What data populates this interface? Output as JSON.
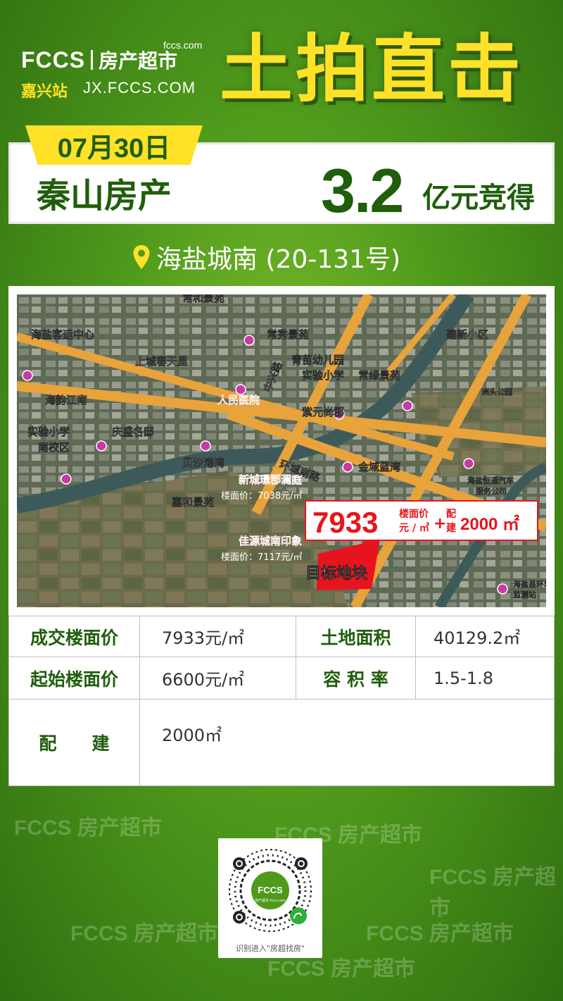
{
  "header": {
    "logo_small": "fccs.com",
    "logo_brand": "FCCS",
    "logo_cn": "房产超市",
    "station": "嘉兴站",
    "station_url": "JX.FCCS.COM",
    "headline": "土拍直击"
  },
  "result": {
    "date": "07月30日",
    "winner": "秦山房产",
    "price": "3.2",
    "price_suffix": "亿元竞得"
  },
  "location": {
    "icon": "map-pin-icon",
    "text": "海盐城南 (20-131号)"
  },
  "map": {
    "labels": {
      "changhe": "常和景苑",
      "keyun": "海盐客运中心",
      "changxiu": "常秀景苑",
      "jianxin": "建新小区",
      "qingmiao": "青苗幼儿园",
      "shiyan": "实验小学",
      "changlv": "常绿景苑",
      "shangcheng": "上城春天里",
      "haiyun": "海韵江南",
      "renmin": "人民医院",
      "ziyuan": "紫元尚郡",
      "zhongxing_road": "中兴路",
      "shiyan_south": "实验小学\n南校区",
      "qingsheng": "庆盛名邸",
      "beisha": "贝沙港湾",
      "huancheng_road": "环城南路",
      "jinyu": "金域蓝湾",
      "xincheng": "新城璟郡澜庭",
      "xincheng_price": "楼面价：7038元/㎡",
      "jiahe": "嘉和景苑",
      "jiayuan": "佳源城南印象",
      "jiayuan_price": "楼面价：7117元/㎡",
      "target": "目标地块",
      "hengtong": "海盐恒通汽车\n服务公司",
      "zhoutou": "洲头公园",
      "huanjing": "海盐县环境\n监测站"
    },
    "callout": {
      "price": "7933",
      "unit_top": "楼面价",
      "unit_bottom": "元 / ㎡",
      "plus": "+",
      "extra_label_top": "配",
      "extra_label_bottom": "建",
      "extra_value": "2000 ㎡"
    }
  },
  "table": {
    "rows": [
      {
        "label1": "成交楼面价",
        "value1": "7933元/㎡",
        "label2": "土地面积",
        "value2": "40129.2㎡"
      },
      {
        "label1": "起始楼面价",
        "value1": "6600元/㎡",
        "label2": "容 积 率",
        "value2": "1.5-1.8"
      },
      {
        "label1": "配　　建",
        "value1": "2000㎡"
      }
    ]
  },
  "qr": {
    "center_logo": "FCCS",
    "center_cn": "房产超市 fccs.com",
    "caption": "识别进入\"房超找房\""
  },
  "watermark": "FCCS 房产超市",
  "colors": {
    "accent_yellow": "#ffe227",
    "dark_green": "#1f5e0b",
    "target_red": "#e8141d"
  }
}
